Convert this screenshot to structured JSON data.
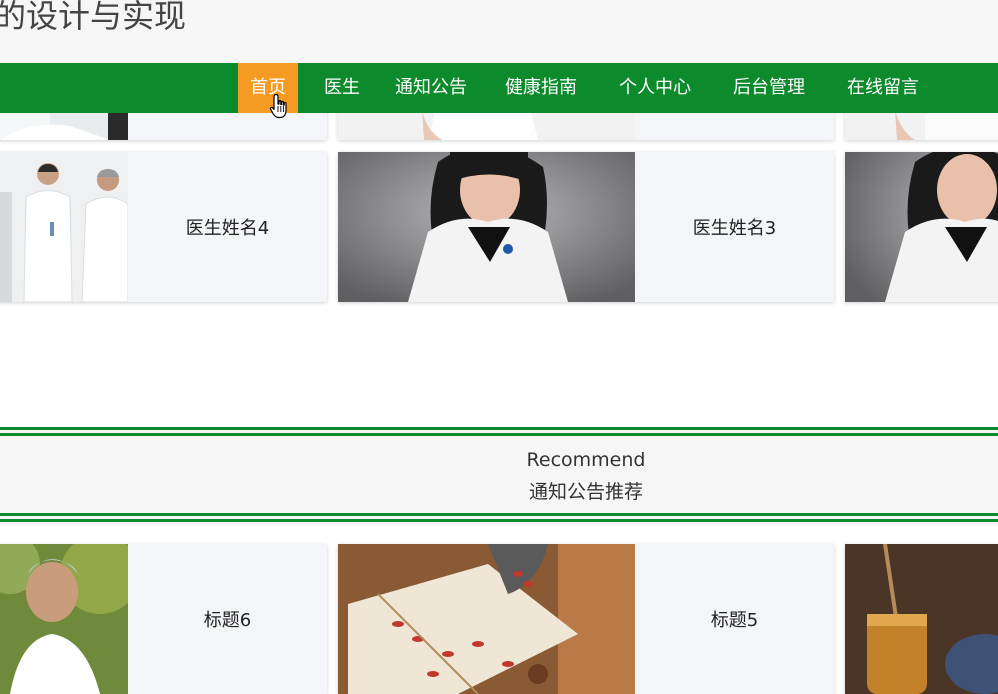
{
  "header": {
    "site_title": "的设计与实现"
  },
  "nav": {
    "items": [
      {
        "label": "首页",
        "active": true
      },
      {
        "label": "医生"
      },
      {
        "label": "通知公告"
      },
      {
        "label": "健康指南"
      },
      {
        "label": "个人中心"
      },
      {
        "label": "后台管理"
      },
      {
        "label": "在线留言"
      }
    ],
    "colors": {
      "bar": "#0d8a2c",
      "active": "#f59a23",
      "text": "#ffffff"
    }
  },
  "doctors": {
    "cards": [
      {
        "name": "医生姓名4",
        "image": "doctors-consulting-photo"
      },
      {
        "name": "医生姓名3",
        "image": "female-doctor-photo"
      },
      {
        "name": "",
        "image": "female-doctor-photo"
      }
    ]
  },
  "recommend_section": {
    "title_en": "Recommend",
    "title_cn": "通知公告推荐"
  },
  "notices": {
    "cards": [
      {
        "title": "标题6",
        "image": "smiling-elderly-man-photo"
      },
      {
        "title": "标题5",
        "image": "goji-berries-herbal-photo"
      },
      {
        "title": "",
        "image": "honey-jar-photo"
      }
    ]
  }
}
